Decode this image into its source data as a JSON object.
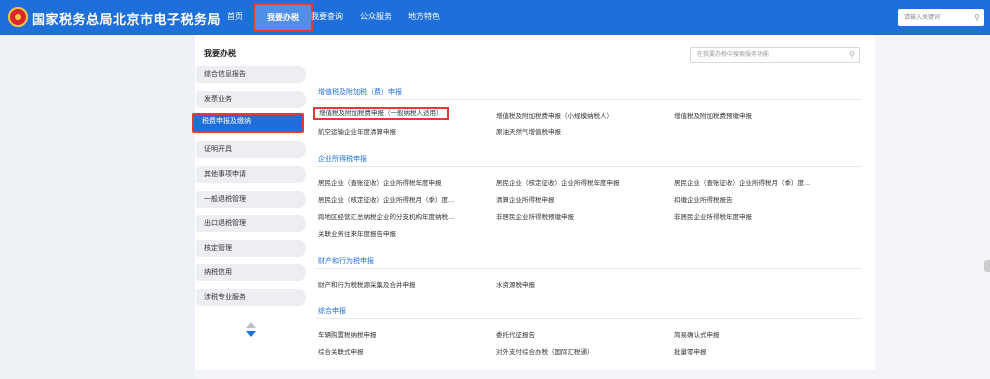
{
  "header": {
    "site_title": "国家税务总局北京市电子税务局",
    "nav": [
      {
        "label": "首页"
      },
      {
        "label": "我要办税"
      },
      {
        "label": "我要查询"
      },
      {
        "label": "公众服务"
      },
      {
        "label": "地方特色"
      }
    ],
    "search_placeholder": "请输入关键词"
  },
  "sidebar": {
    "title": "我要办税",
    "items": [
      {
        "label": "综合信息报告"
      },
      {
        "label": "发票业务"
      },
      {
        "label": "税费申报及缴纳"
      },
      {
        "label": "证明开具"
      },
      {
        "label": "其他事项申请"
      },
      {
        "label": "一般退税管理"
      },
      {
        "label": "出口退税管理"
      },
      {
        "label": "核定管理"
      },
      {
        "label": "纳税信用"
      },
      {
        "label": "涉税专业服务"
      }
    ]
  },
  "main": {
    "search_placeholder": "在我要办税中搜索服务功能",
    "sections": [
      {
        "title": "增值税及附加税（费）申报",
        "links": [
          "增值税及附加税费申报（一般纳税人适用）",
          "增值税及附加税费申报（小规模纳税人）",
          "增值税及附加税费预缴申报",
          "航空运输企业年度清算申报",
          "原油天然气增值税申报"
        ]
      },
      {
        "title": "企业所得税申报",
        "links": [
          "居民企业（查账征收）企业所得税年度申报",
          "居民企业（核定征收）企业所得税年度申报",
          "居民企业（查账征收）企业所得税月（季）度...",
          "居民企业（核定征收）企业所得税月（季）度...",
          "清算企业所得税申报",
          "扣缴企业所得税报告",
          "跨地区经营汇总纳税企业的分支机构年度纳税...",
          "非居民企业所得税预缴申报",
          "非居民企业所得税年度申报",
          "关联业务往来年度报告申报"
        ]
      },
      {
        "title": "财产和行为税申报",
        "links": [
          "财产和行为税税源采集及合并申报",
          "水资源税申报"
        ]
      },
      {
        "title": "综合申报",
        "links": [
          "车辆购置税纳税申报",
          "委托代征报告",
          "简易确认式申报",
          "综合关联式申报",
          "对外支付综合办税（国际汇税通）",
          "批量零申报"
        ]
      }
    ]
  },
  "colors": {
    "brand_blue": "#1e6fd9",
    "highlight_red": "#e53935"
  }
}
